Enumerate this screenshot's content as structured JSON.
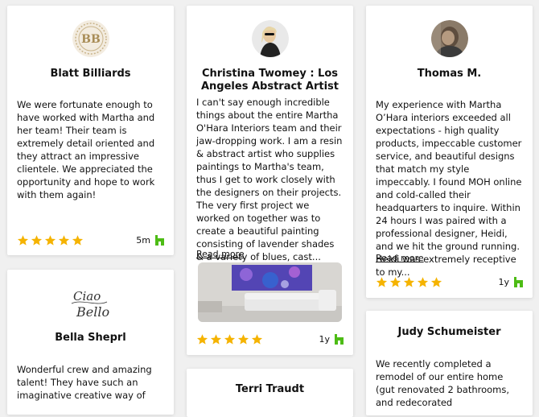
{
  "colors": {
    "star": "#f5b301",
    "houzz": "#4dbc15",
    "background": "#f0f0f0",
    "card": "#ffffff"
  },
  "reviews": [
    {
      "name": "Blatt Billiards",
      "avatar": "bb-monogram-logo",
      "text": "We were fortunate enough to have worked with Martha and her team! Their team is extremely detail oriented and they attract an impressive clientele. We appreciated the opportunity and hope to work with them again!",
      "rating": 5,
      "age": "5m",
      "source_icon": "houzz-icon"
    },
    {
      "name": "Christina Twomey : Los Angeles Abstract Artist",
      "avatar": "woman-portrait",
      "text": "I can't say enough incredible things about the entire Martha O'Hara Interiors team and their jaw-dropping work. I am a resin & abstract artist who supplies paintings to Martha's team, thus I get to work closely with the designers on their projects. The very first project we worked on together was to create a beautiful painting consisting of lavender shades & a variety of blues, cast...",
      "read_more": "Read more",
      "photo": "living-room-with-abstract-painting",
      "rating": 5,
      "age": "1y",
      "source_icon": "houzz-icon"
    },
    {
      "name": "Thomas M.",
      "avatar": "man-portrait",
      "text": "My experience with Martha O’Hara interiors exceeded all expectations - high quality products, impeccable customer service, and beautiful designs that match my style impeccably. I found MOH online and cold-called their headquarters to inquire. Within 24 hours I was paired with a professional designer, Heidi, and we hit the ground running. Heidi was extremely receptive to my...",
      "read_more": "Read more",
      "rating": 5,
      "age": "1y",
      "source_icon": "houzz-icon"
    },
    {
      "name": "Bella Sheprl",
      "avatar": "ciao-bello-logo",
      "logo_text": "Ciao Bello",
      "text": "Wonderful crew and amazing talent! They have such an imaginative creative way of"
    },
    {
      "name": "Terri Traudt"
    },
    {
      "name": "Judy Schumeister",
      "text": "We recently completed a remodel of our entire home (gut renovated 2 bathrooms, and redecorated"
    }
  ]
}
